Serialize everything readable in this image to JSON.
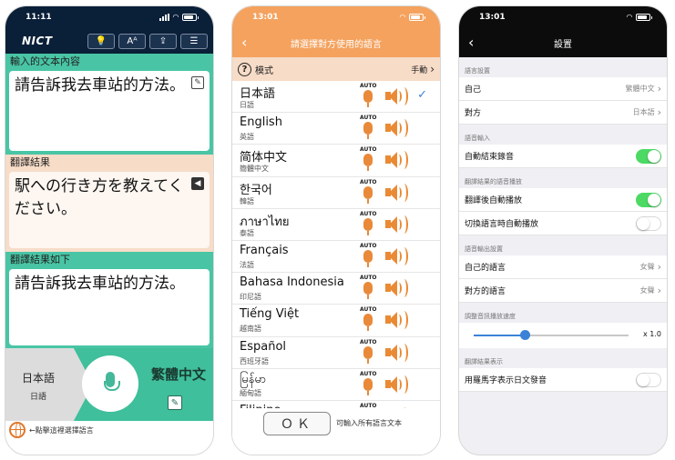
{
  "translate_screen": {
    "status_time": "11:11",
    "logo": "NICT",
    "toolbar": [
      {
        "label": "💡",
        "icon": "lightbulb-icon"
      },
      {
        "label": "Aᴬ",
        "icon": "font-size-icon"
      },
      {
        "label": "⇪",
        "icon": "share-icon"
      },
      {
        "label": "☰",
        "icon": "menu-icon"
      }
    ],
    "input_header": "輸入的文本內容",
    "input_text": "請告訴我去車站的方法。",
    "result_header": "翻譯結果",
    "result_text": "駅への行き方を教えてください。",
    "back_header": "翻譯結果如下",
    "back_text": "請告訴我去車站的方法。",
    "source_lang": "日本語",
    "source_lang_sub": "日語",
    "target_lang": "繁體中文",
    "hint": "←點擊這裡選擇語言"
  },
  "language_screen": {
    "status_time": "13:01",
    "title": "請選擇對方使用的語言",
    "mode_label": "模式",
    "mode_value": "手動",
    "auto_label": "AUTO",
    "languages": [
      {
        "name": "日本語",
        "sub": "日語",
        "selected": true
      },
      {
        "name": "English",
        "sub": "英語",
        "selected": false
      },
      {
        "name": "简体中文",
        "sub": "簡體中文",
        "selected": false
      },
      {
        "name": "한국어",
        "sub": "韓語",
        "selected": false
      },
      {
        "name": "ภาษาไทย",
        "sub": "泰語",
        "selected": false
      },
      {
        "name": "Français",
        "sub": "法語",
        "selected": false
      },
      {
        "name": "Bahasa Indonesia",
        "sub": "印尼語",
        "selected": false
      },
      {
        "name": "Tiếng Việt",
        "sub": "越南語",
        "selected": false
      },
      {
        "name": "Español",
        "sub": "西班牙語",
        "selected": false
      },
      {
        "name": "မြန်မာ",
        "sub": "緬甸語",
        "selected": false
      },
      {
        "name": "Filipino",
        "sub": "",
        "selected": false
      }
    ],
    "ok_label": "ＯＫ",
    "footer_text": "可輸入所有語言文本"
  },
  "settings_screen": {
    "status_time": "13:01",
    "title": "設置",
    "sections": [
      {
        "header": "語言設置",
        "rows": [
          {
            "label": "自己",
            "type": "value",
            "value": "繁體中文"
          },
          {
            "label": "對方",
            "type": "value",
            "value": "日本語"
          }
        ]
      },
      {
        "header": "語音輸入",
        "rows": [
          {
            "label": "自動結束錄音",
            "type": "toggle",
            "on": true
          }
        ]
      },
      {
        "header": "翻譯結果的語音播放",
        "rows": [
          {
            "label": "翻譯後自動播放",
            "type": "toggle",
            "on": true
          },
          {
            "label": "切換語言時自動播放",
            "type": "toggle",
            "on": false
          }
        ]
      },
      {
        "header": "語音輸出設置",
        "rows": [
          {
            "label": "自己的語言",
            "type": "value",
            "value": "女聲"
          },
          {
            "label": "對方的語言",
            "type": "value",
            "value": "女聲"
          }
        ]
      },
      {
        "header": "調整音訊播放速度",
        "rows": [
          {
            "label": "",
            "type": "slider",
            "fraction": 0.33,
            "value": "x 1.0"
          }
        ]
      },
      {
        "header": "翻譯結果表示",
        "rows": [
          {
            "label": "用羅馬字表示日文發音",
            "type": "toggle",
            "on": false
          }
        ]
      }
    ]
  }
}
